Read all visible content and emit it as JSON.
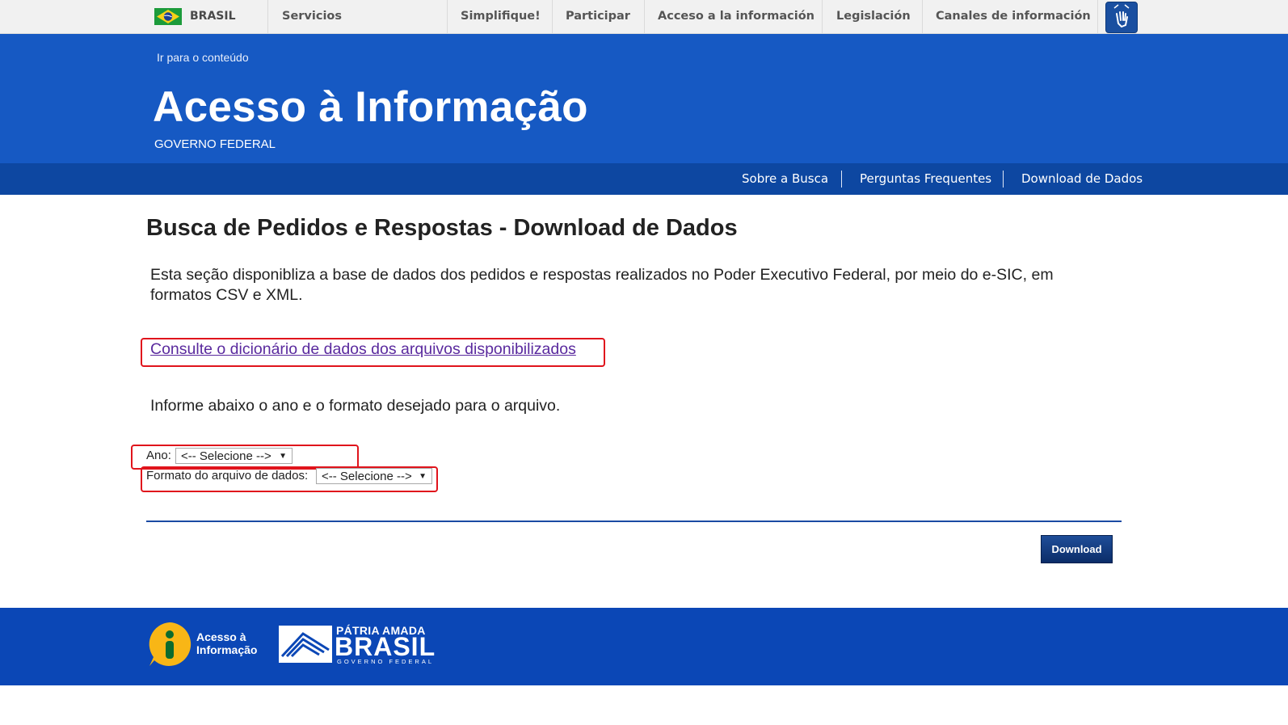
{
  "govbar": {
    "brasil": "BRASIL",
    "items": [
      "Servicios",
      "Simplifique!",
      "Participar",
      "Acceso a la información",
      "Legislación",
      "Canales de información"
    ]
  },
  "header": {
    "skip_link": "Ir para o conteúdo",
    "title": "Acesso à Informação",
    "subtitle": "GOVERNO FEDERAL"
  },
  "subnav": {
    "items": [
      "Sobre a Busca",
      "Perguntas Frequentes",
      "Download de Dados"
    ]
  },
  "main": {
    "page_title": "Busca de Pedidos e Respostas - Download de Dados",
    "intro": "Esta seção disponibliza a base de dados dos pedidos e respostas realizados no Poder Executivo Federal, por meio do e-SIC, em formatos CSV e XML.",
    "dictionary_link": "Consulte o dicionário de dados dos arquivos disponibilizados",
    "instruction": "Informe abaixo o ano e o formato desejado para o arquivo.",
    "year_label": "Ano:",
    "year_value": "<-- Selecione -->",
    "format_label": "Formato do arquivo de dados:",
    "format_value": "<-- Selecione -->",
    "download_button": "Download"
  },
  "footer": {
    "info_logo_line1": "Acesso à",
    "info_logo_line2": "Informação",
    "patria_line1": "PÁTRIA AMADA",
    "patria_line2": "BRASIL",
    "patria_line3": "GOVERNO FEDERAL"
  },
  "colors": {
    "header_blue": "#1659c3",
    "subnav_blue": "#0d47a1",
    "footer_blue": "#0b47b6",
    "highlight_red": "#e0141c",
    "link_purple": "#5a2a9e"
  }
}
